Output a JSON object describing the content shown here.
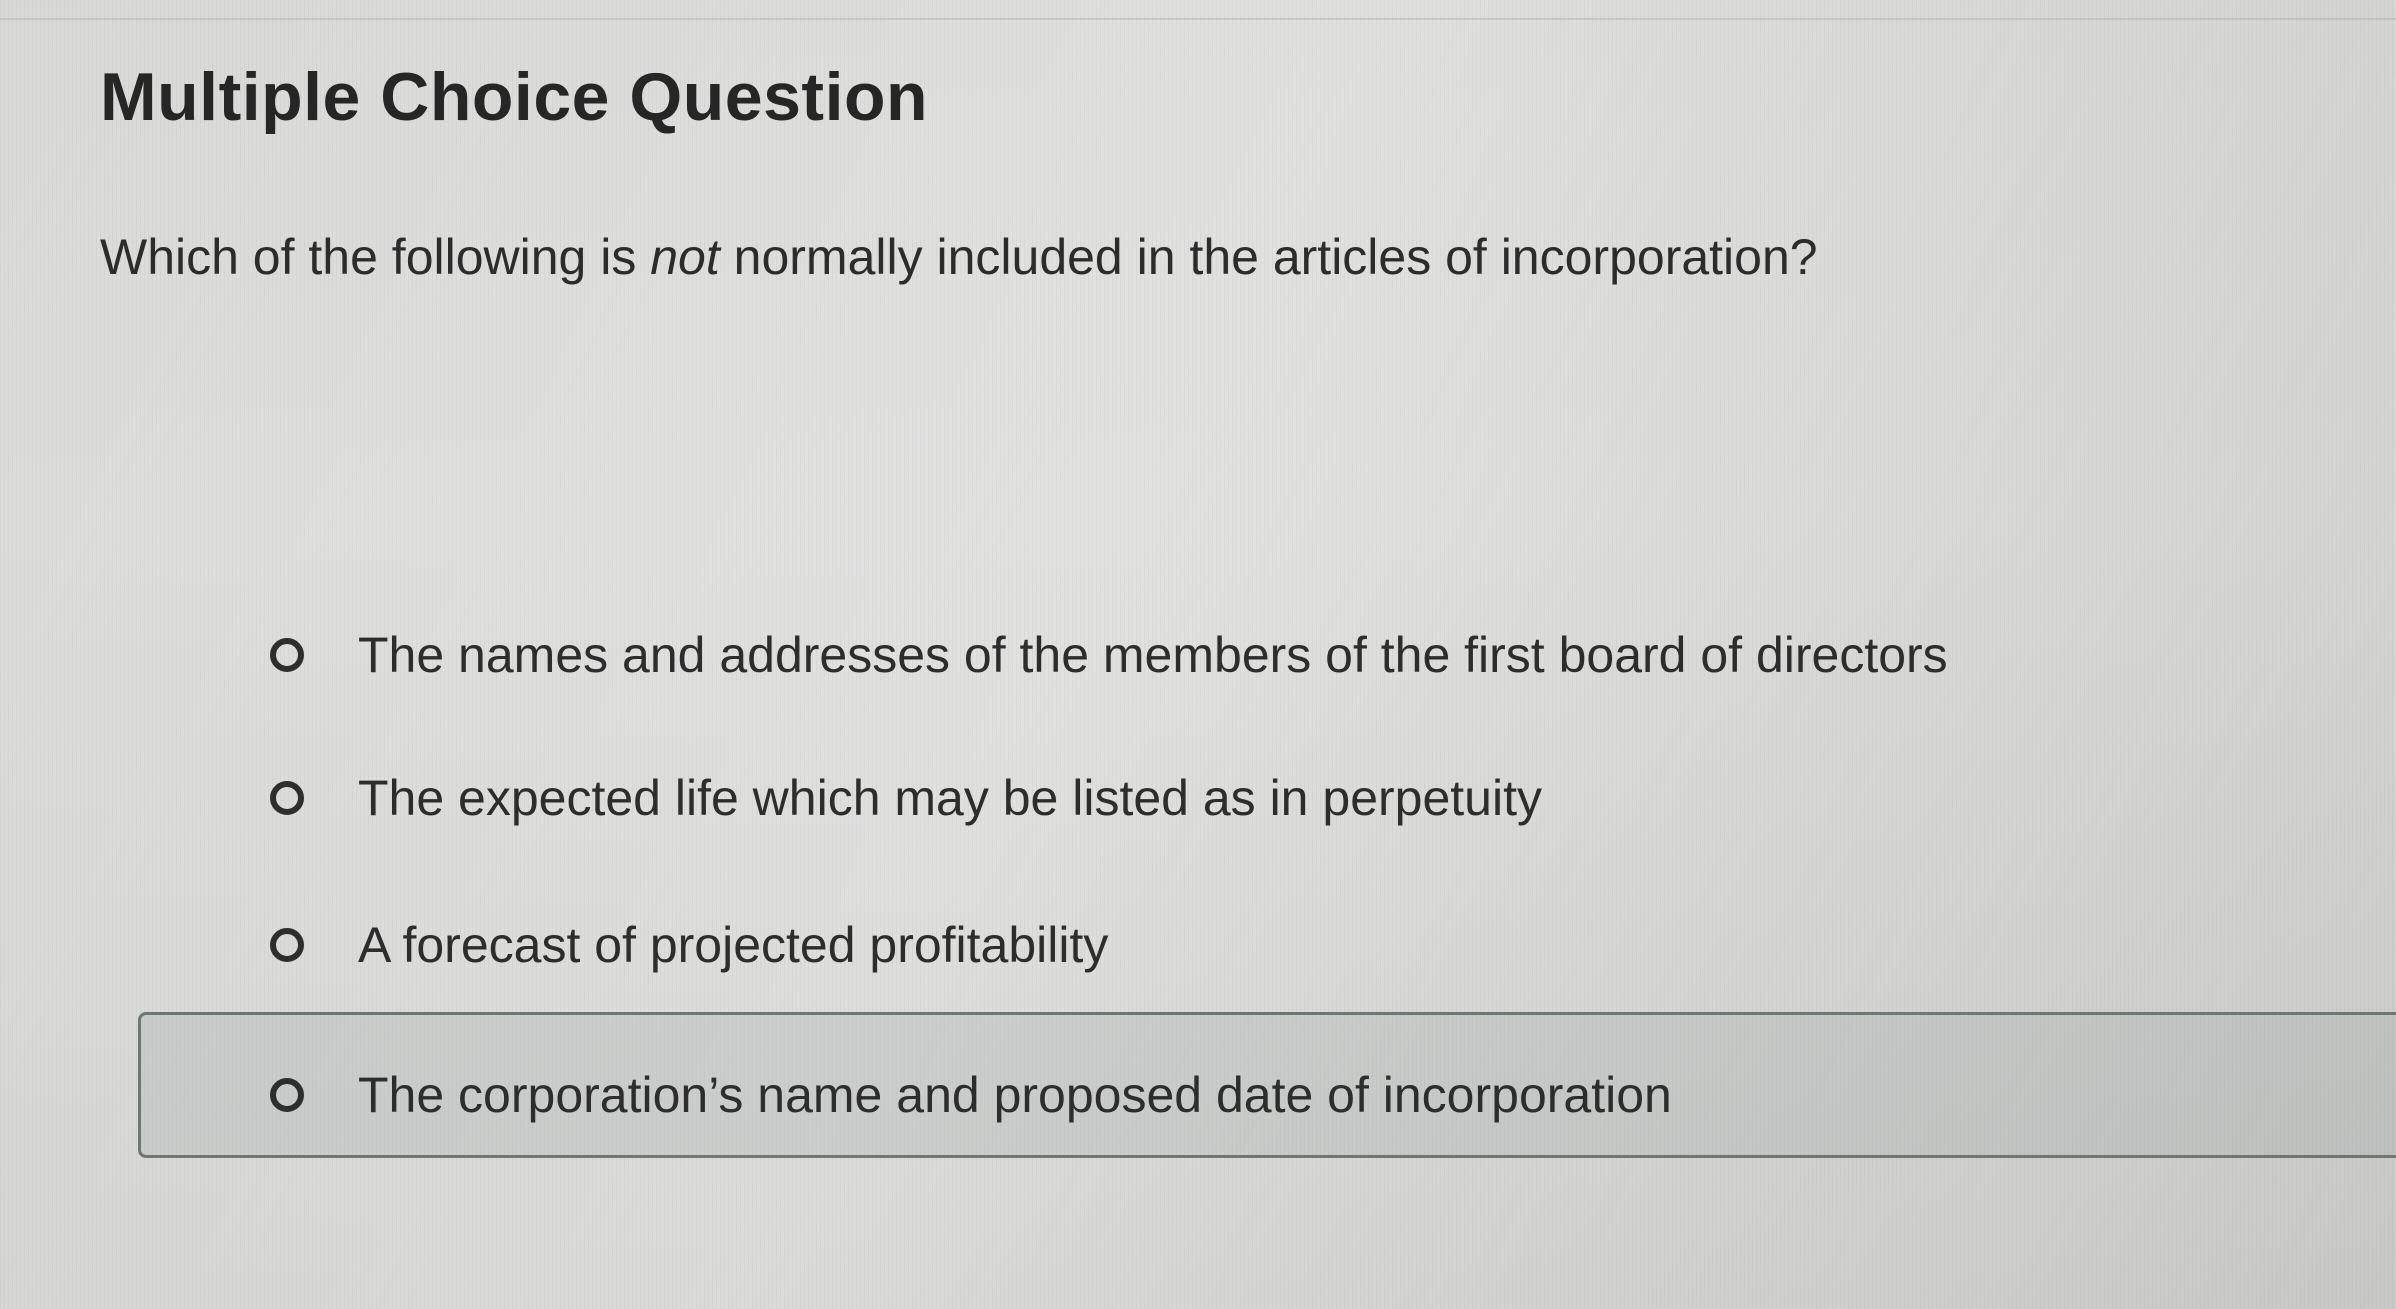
{
  "question": {
    "title": "Multiple Choice Question",
    "prompt_before": "Which of the following is ",
    "prompt_emphasis": "not",
    "prompt_after": " normally included in the articles of incorporation?"
  },
  "options": [
    {
      "label": "The names and addresses of the members of the first board of directors",
      "selected": false
    },
    {
      "label": "The expected life which may be listed as in perpetuity",
      "selected": false
    },
    {
      "label": "A forecast of projected profitability",
      "selected": false
    },
    {
      "label": "The corporation’s name and proposed date of incorporation",
      "selected": false,
      "highlighted": true
    }
  ]
}
